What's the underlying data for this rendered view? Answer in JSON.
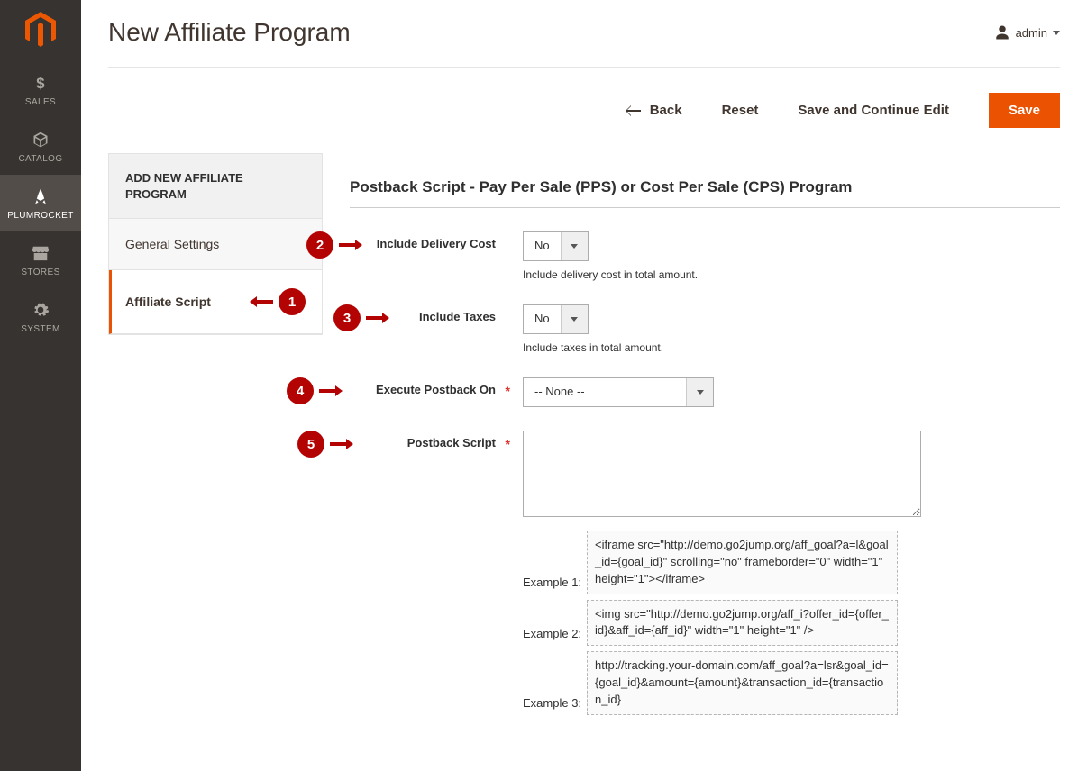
{
  "header": {
    "page_title": "New Affiliate Program",
    "user_label": "admin"
  },
  "actions": {
    "back": "Back",
    "reset": "Reset",
    "save_continue": "Save and Continue Edit",
    "save": "Save"
  },
  "nav": {
    "sales": "SALES",
    "catalog": "CATALOG",
    "plumrocket": "PLUMROCKET",
    "stores": "STORES",
    "system": "SYSTEM"
  },
  "side_panel": {
    "header": "ADD NEW AFFILIATE PROGRAM",
    "items": [
      {
        "label": "General Settings"
      },
      {
        "label": "Affiliate Script"
      }
    ]
  },
  "section": {
    "title": "Postback Script - Pay Per Sale (PPS) or Cost Per Sale (CPS) Program"
  },
  "fields": {
    "include_delivery": {
      "label": "Include Delivery Cost",
      "value": "No",
      "hint": "Include delivery cost in total amount."
    },
    "include_taxes": {
      "label": "Include Taxes",
      "value": "No",
      "hint": "Include taxes in total amount."
    },
    "execute_postback": {
      "label": "Execute Postback On",
      "value": "-- None --"
    },
    "postback_script": {
      "label": "Postback Script",
      "value": ""
    }
  },
  "examples": {
    "ex1_label": "Example 1:",
    "ex1_text": "<iframe src=\"http://demo.go2jump.org/aff_goal?a=l&goal_id={goal_id}\" scrolling=\"no\" frameborder=\"0\" width=\"1\" height=\"1\"></iframe>",
    "ex2_label": "Example 2:",
    "ex2_text": "<img src=\"http://demo.go2jump.org/aff_i?offer_id={offer_id}&aff_id={aff_id}\" width=\"1\" height=\"1\" />",
    "ex3_label": "Example 3:",
    "ex3_text": "http://tracking.your-domain.com/aff_goal?a=lsr&goal_id={goal_id}&amount={amount}&transaction_id={transaction_id}"
  },
  "callouts": {
    "c1": "1",
    "c2": "2",
    "c3": "3",
    "c4": "4",
    "c5": "5"
  }
}
